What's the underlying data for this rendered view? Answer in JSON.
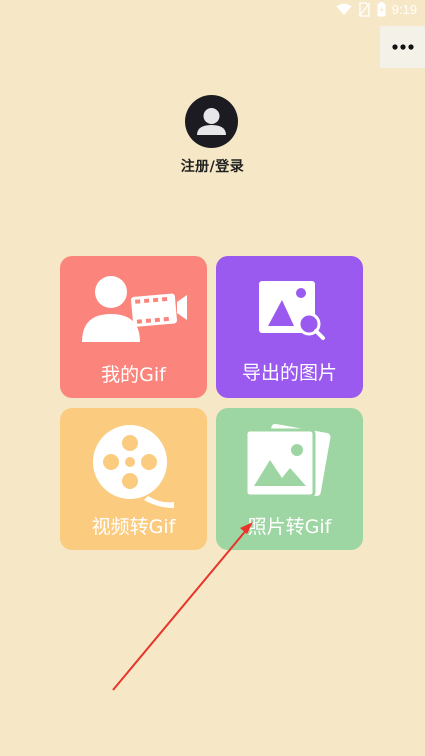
{
  "status_bar": {
    "time": "9:19",
    "icons": [
      "wifi-icon",
      "no-sim-icon",
      "battery-icon"
    ]
  },
  "header": {
    "more_icon": "more-horizontal-icon"
  },
  "profile": {
    "login_label": "注册/登录",
    "avatar_icon": "user-avatar-icon"
  },
  "tiles": [
    {
      "label": "我的Gif",
      "icon": "person-film-icon",
      "color": "#fb857c"
    },
    {
      "label": "导出的图片",
      "icon": "image-search-icon",
      "color": "#9a59ef"
    },
    {
      "label": "视频转Gif",
      "icon": "film-reel-icon",
      "color": "#fbcb80"
    },
    {
      "label": "照片转Gif",
      "icon": "photos-icon",
      "color": "#9ed6a3"
    }
  ],
  "colors": {
    "background": "#f6e8c6",
    "arrow": "#e8332a"
  }
}
